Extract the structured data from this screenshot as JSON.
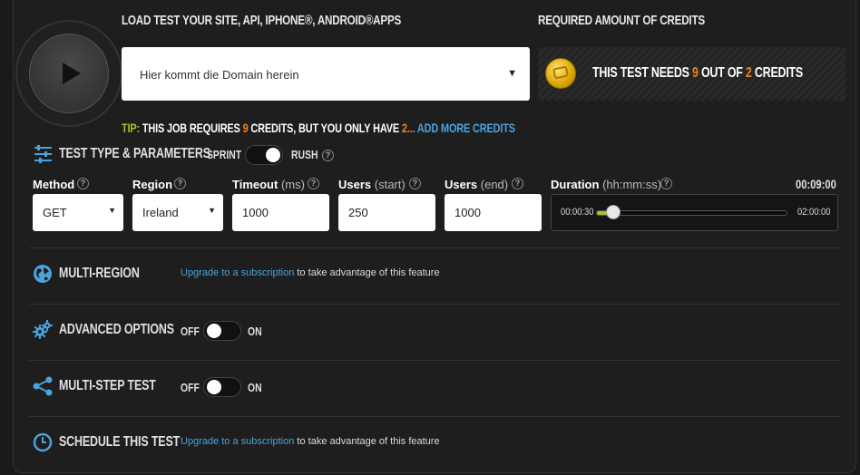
{
  "header": {
    "title": "LOAD TEST YOUR SITE, API, IPHONE®, ANDROID®APPS",
    "credits_title": "REQUIRED AMOUNT OF CREDITS"
  },
  "domain": {
    "value": "Hier kommt die Domain herein",
    "arrow": "▼"
  },
  "credits": {
    "prefix": "THIS TEST NEEDS",
    "needed": "9",
    "mid": "OUT OF",
    "have": "2",
    "suffix": "CREDITS"
  },
  "tip": {
    "label": "TIP:",
    "text1": "THIS JOB REQUIRES",
    "needed": "9",
    "text2": "CREDITS, BUT YOU ONLY HAVE",
    "have": "2",
    "ellipsis": "...",
    "link": "ADD MORE CREDITS"
  },
  "params": {
    "title": "TEST TYPE & PARAMETERS",
    "sprint": "SPRINT",
    "rush": "RUSH",
    "help": "?"
  },
  "fields": {
    "method": {
      "label": "Method",
      "value": "GET"
    },
    "region": {
      "label": "Region",
      "value": "Ireland"
    },
    "timeout": {
      "label": "Timeout",
      "unit": "(ms)",
      "value": "1000"
    },
    "users_start": {
      "label": "Users",
      "unit": "(start)",
      "value": "250"
    },
    "users_end": {
      "label": "Users",
      "unit": "(end)",
      "value": "1000"
    },
    "duration": {
      "label": "Duration",
      "unit": "(hh:mm:ss)",
      "value": "00:09:00",
      "min": "00:00:30",
      "max": "02:00:00",
      "fraction": 0.07
    }
  },
  "sections": {
    "multi_region": {
      "title": "MULTI-REGION",
      "link": "Upgrade to a subscription",
      "text": " to take advantage of this feature"
    },
    "advanced": {
      "title": "ADVANCED OPTIONS",
      "off": "OFF",
      "on": "ON"
    },
    "multi_step": {
      "title": "MULTI-STEP TEST",
      "off": "OFF",
      "on": "ON"
    },
    "schedule": {
      "title": "SCHEDULE THIS TEST",
      "link": "Upgrade to a subscription",
      "text": " to take advantage of this feature"
    }
  },
  "colors": {
    "accent_green": "#a3c52b",
    "accent_orange": "#f0821e",
    "link_blue": "#4aa3df"
  }
}
